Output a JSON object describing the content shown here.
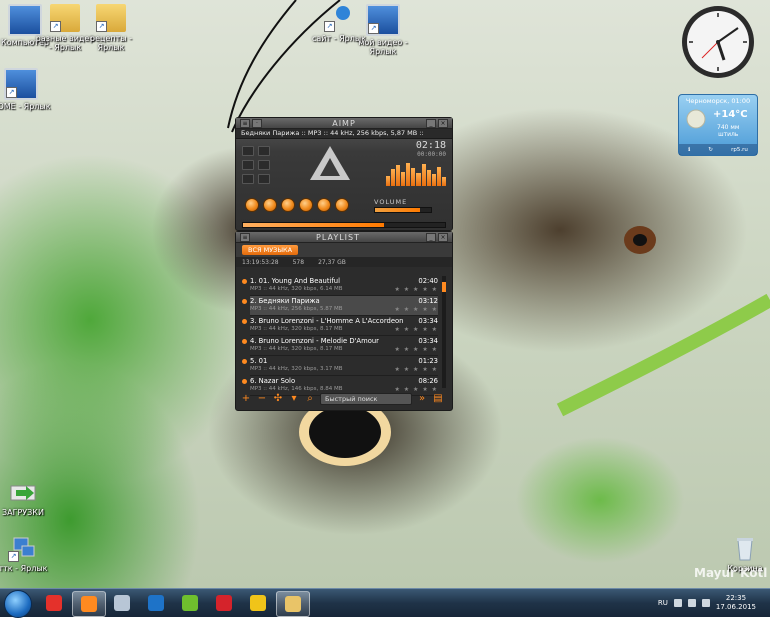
{
  "desktop": {
    "icons": [
      {
        "label": "Компьютер",
        "type": "monitor"
      },
      {
        "label": "разные видео - Ярлык",
        "type": "folder"
      },
      {
        "label": "рецепты - Ярлык",
        "type": "folder"
      },
      {
        "label": "сайт - Ярлык",
        "type": "pin"
      },
      {
        "label": "мой видео - Ярлык",
        "type": "monitor"
      },
      {
        "label": "HOME - Ярлык",
        "type": "monitor"
      },
      {
        "label": "ЗАГРУЗКИ",
        "type": "download"
      },
      {
        "label": "ттк - Ярлык",
        "type": "network"
      },
      {
        "label": "Корзина",
        "type": "recycle"
      }
    ],
    "watermark": "Mayur Kotl"
  },
  "weather": {
    "city": "Черноморск, 01:00",
    "temp": "+14°C",
    "pressure_value": "740 мм",
    "pressure_desc": "штиль",
    "source": "rp5.ru"
  },
  "aimp": {
    "title": "AIMP",
    "track_line": "Бедняки Парижа :: MP3 :: 44 kHz, 256 kbps, 5,87 MB ::",
    "time_main": "02:18",
    "time_sub": "00:00:00",
    "volume_label": "VOLUME",
    "volume_level": 0.8,
    "progress": 0.7
  },
  "playlist": {
    "title": "PLAYLIST",
    "tab_label": "ВСЯ МУЗЫКА",
    "info": {
      "duration": "13:19:53:28",
      "count": "578",
      "size": "27,37 GB"
    },
    "tracks": [
      {
        "name": "1. 01. Young And Beautiful",
        "dur": "02:40",
        "meta": "MP3 :: 44 kHz, 320 kbps, 6.14 MB",
        "stars": "★ ★ ★ ★ ★"
      },
      {
        "name": "2. Бедняки Парижа",
        "dur": "03:12",
        "meta": "MP3 :: 44 kHz, 256 kbps, 5.87 MB",
        "stars": "★ ★ ★ ★ ★"
      },
      {
        "name": "3. Bruno Lorenzoni - L'Homme A L'Accordeon",
        "dur": "03:34",
        "meta": "MP3 :: 44 kHz, 320 kbps, 8.17 MB",
        "stars": "★ ★ ★ ★ ★"
      },
      {
        "name": "4. Bruno Lorenzoni - Melodie D'Amour",
        "dur": "03:34",
        "meta": "MP3 :: 44 kHz, 320 kbps, 8.17 MB",
        "stars": "★ ★ ★ ★ ★"
      },
      {
        "name": "5. 01",
        "dur": "01:23",
        "meta": "MP3 :: 44 kHz, 320 kbps, 3.17 MB",
        "stars": "★ ★ ★ ★ ★"
      },
      {
        "name": "6. Nazar Solo",
        "dur": "08:26",
        "meta": "MP3 :: 44 kHz, 146 kbps, 8.84 MB",
        "stars": "★ ★ ★ ★ ★"
      }
    ],
    "selected_index": 1,
    "search_placeholder": "Быстрый поиск"
  },
  "taskbar": {
    "apps": [
      {
        "name": "start-x-icon",
        "color": "#e4312b",
        "active": false
      },
      {
        "name": "aimp-icon",
        "color": "#ff8a20",
        "active": true
      },
      {
        "name": "calculator-icon",
        "color": "#b8c6d6",
        "active": false
      },
      {
        "name": "maxthon-icon",
        "color": "#1e73c8",
        "active": false
      },
      {
        "name": "utorrent-icon",
        "color": "#6fbf2e",
        "active": false
      },
      {
        "name": "opera-icon",
        "color": "#d5232b",
        "active": false
      },
      {
        "name": "chrome-icon",
        "color": "#f0c419",
        "active": false
      },
      {
        "name": "explorer-icon",
        "color": "#e9c468",
        "active": true
      }
    ],
    "lang": "RU",
    "time": "22:35",
    "date": "17.06.2015"
  }
}
